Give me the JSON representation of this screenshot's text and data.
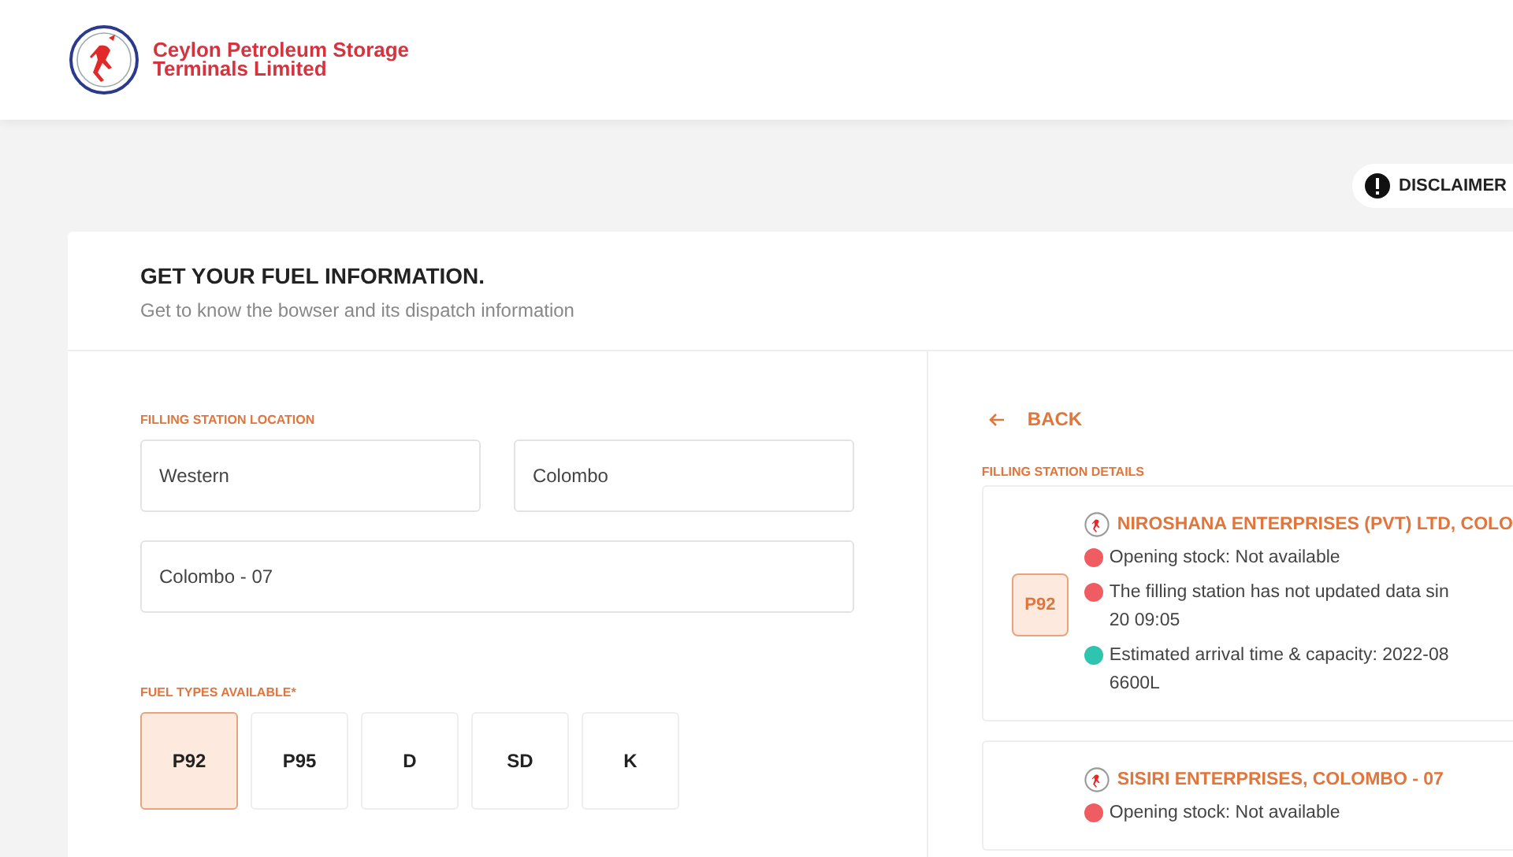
{
  "header": {
    "logo_lines": [
      "Ceylon Petroleum Storage",
      "Terminals Limited"
    ]
  },
  "disclaimer": {
    "label": "DISCLAIMER"
  },
  "intro": {
    "title": "GET YOUR FUEL INFORMATION.",
    "subtitle": "Get to know the bowser and its dispatch information"
  },
  "location": {
    "label": "FILLING STATION LOCATION",
    "province": "Western",
    "district": "Colombo",
    "city": "Colombo - 07"
  },
  "fuel_types": {
    "label": "FUEL TYPES AVAILABLE*",
    "items": [
      {
        "label": "P92",
        "selected": true
      },
      {
        "label": "P95",
        "selected": false
      },
      {
        "label": "D",
        "selected": false
      },
      {
        "label": "SD",
        "selected": false
      },
      {
        "label": "K",
        "selected": false
      }
    ]
  },
  "details": {
    "back": "BACK",
    "label": "FILLING STATION DETAILS",
    "stations": [
      {
        "fuel": "P92",
        "name": "NIROSHANA ENTERPRISES (PVT) LTD, COLO",
        "statuses": [
          {
            "lines": [
              "Opening stock: Not available"
            ],
            "color": "#ef5d63"
          },
          {
            "lines": [
              "The filling station has not updated data sin",
              "20 09:05"
            ],
            "color": "#ef5d63"
          },
          {
            "lines": [
              "Estimated arrival time & capacity: 2022-08",
              "6600L"
            ],
            "color": "#2ec4b0"
          }
        ]
      },
      {
        "name": "SISIRI ENTERPRISES, COLOMBO - 07",
        "statuses": [
          {
            "lines": [
              "Opening stock: Not available"
            ],
            "color": "#ef5d63"
          }
        ]
      }
    ]
  }
}
